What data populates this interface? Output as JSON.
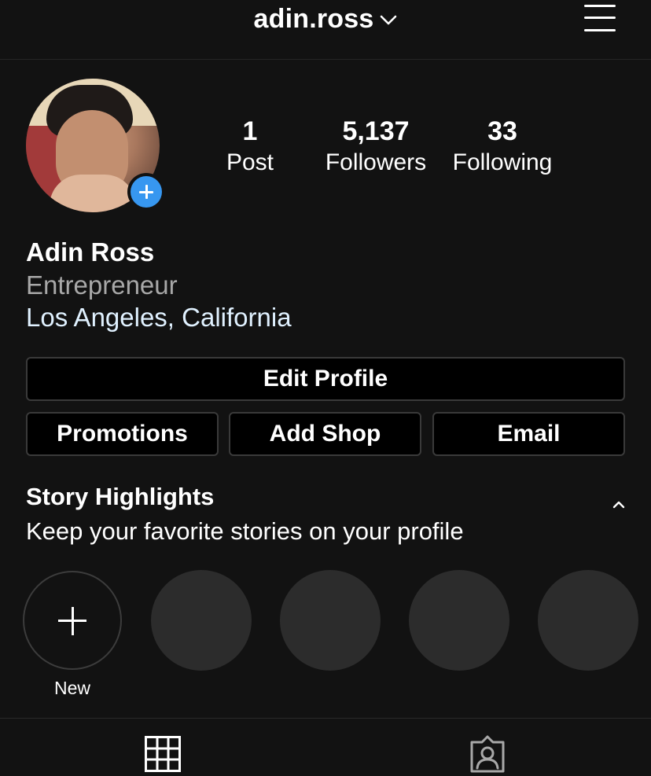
{
  "header": {
    "username": "adin.ross",
    "switch_account_icon": "chevron-down-icon",
    "menu_icon": "hamburger-menu-icon"
  },
  "profile": {
    "add_story_icon": "plus-circle-icon",
    "stats": [
      {
        "value": "1",
        "label": "Post"
      },
      {
        "value": "5,137",
        "label": "Followers"
      },
      {
        "value": "33",
        "label": "Following"
      }
    ],
    "full_name": "Adin Ross",
    "category": "Entrepreneur",
    "location": "Los Angeles, California"
  },
  "buttons": {
    "edit_profile": "Edit Profile",
    "promotions": "Promotions",
    "add_shop": "Add Shop",
    "email": "Email"
  },
  "highlights": {
    "title": "Story Highlights",
    "subtitle": "Keep your favorite stories on your profile",
    "new_label": "New",
    "placeholder_count": 4
  },
  "tabs": [
    {
      "icon": "grid-icon",
      "active": true
    },
    {
      "icon": "tagged-person-icon",
      "active": false
    }
  ],
  "colors": {
    "background": "#121212",
    "accent_blue": "#3797f0",
    "location_text": "#e0f1ff",
    "category_text": "#a8a8a8",
    "button_border": "#3a3a3a"
  }
}
